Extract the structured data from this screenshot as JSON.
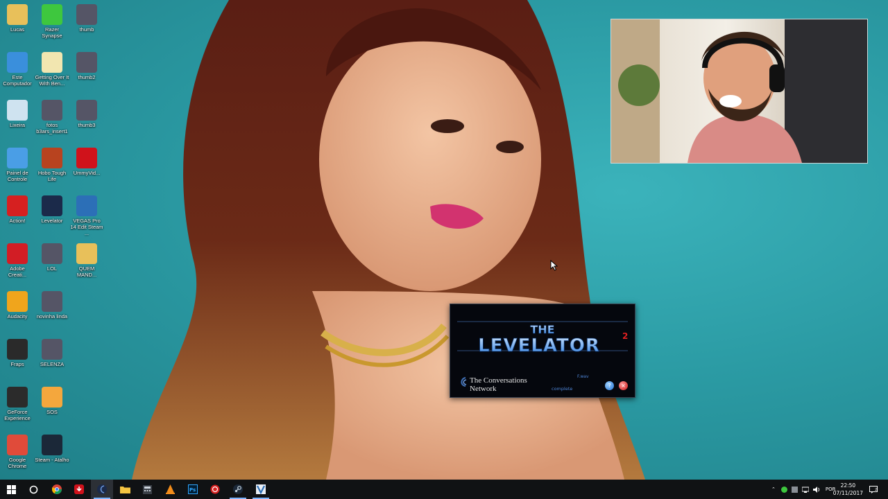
{
  "desktop": {
    "icons": [
      {
        "label": "Lucas",
        "icon": "folder-user-icon",
        "color": "#e8c05a"
      },
      {
        "label": "Razer Synapse",
        "icon": "razer-icon",
        "color": "#3ec73e"
      },
      {
        "label": "thumb",
        "icon": "image-thumb-icon",
        "color": "#556"
      },
      {
        "label": "Este Computador",
        "icon": "computer-icon",
        "color": "#3a8fdc"
      },
      {
        "label": "Getting Over It With Ben...",
        "icon": "file-icon",
        "color": "#f2e6b0"
      },
      {
        "label": "thumb2",
        "icon": "image-thumb-icon",
        "color": "#556"
      },
      {
        "label": "Lixeira",
        "icon": "recycle-bin-icon",
        "color": "#cfe3f0"
      },
      {
        "label": "fotos b3ars_insert1",
        "icon": "image-thumb-icon",
        "color": "#556"
      },
      {
        "label": "thumb3",
        "icon": "image-thumb-icon",
        "color": "#556"
      },
      {
        "label": "Painel de Controle",
        "icon": "control-panel-icon",
        "color": "#4a9ee6"
      },
      {
        "label": "Hobo Tough Life",
        "icon": "game-icon",
        "color": "#b8431f"
      },
      {
        "label": "UmmyVid...",
        "icon": "download-icon",
        "color": "#d0121b"
      },
      {
        "label": "Action!",
        "icon": "record-icon",
        "color": "#d62020"
      },
      {
        "label": "Levelator",
        "icon": "levelator-icon",
        "color": "#1b2a4a"
      },
      {
        "label": "VEGAS Pro 14 Edit Steam ...",
        "icon": "vegas-icon",
        "color": "#2c6fb7"
      },
      {
        "label": "Adobe Creati...",
        "icon": "adobe-cc-icon",
        "color": "#d21d25"
      },
      {
        "label": "LOL",
        "icon": "image-thumb-icon",
        "color": "#556"
      },
      {
        "label": "QUEM MAND...",
        "icon": "folder-icon",
        "color": "#e8c05a"
      },
      {
        "label": "Audacity",
        "icon": "audacity-icon",
        "color": "#f0a51c"
      },
      {
        "label": "novinha linda",
        "icon": "image-thumb-icon",
        "color": "#556"
      },
      {
        "label": "Fraps",
        "icon": "fraps-icon",
        "color": "#2a2a2a"
      },
      {
        "label": "SELENZA",
        "icon": "image-thumb-icon",
        "color": "#556"
      },
      {
        "label": "GeForce Experience",
        "icon": "nvidia-icon",
        "color": "#2b2b2b"
      },
      {
        "label": "SOS",
        "icon": "sos-icon",
        "color": "#f4a73d"
      },
      {
        "label": "Google Chrome",
        "icon": "chrome-icon",
        "color": "#e04b3a"
      },
      {
        "label": "Steam - Atalho",
        "icon": "steam-icon",
        "color": "#1b2838"
      }
    ]
  },
  "levelator": {
    "logo_line1": "THE",
    "logo_line2": "LEVELATOR",
    "logo_sup": "2",
    "network_line1": "The Conversations",
    "network_line2": "Network",
    "file": "F.wav",
    "status": "complete",
    "help_label": "?",
    "close_label": "×"
  },
  "taskbar": {
    "language": "POR",
    "time": "22:50",
    "date": "07/11/2017",
    "apps": [
      {
        "name": "start-button",
        "icon": "windows-icon"
      },
      {
        "name": "search-button",
        "icon": "search-icon"
      },
      {
        "name": "taskbar-chrome",
        "icon": "chrome-icon"
      },
      {
        "name": "taskbar-ummy",
        "icon": "download-icon"
      },
      {
        "name": "taskbar-levelator",
        "icon": "levelator-icon"
      },
      {
        "name": "taskbar-explorer",
        "icon": "folder-icon"
      },
      {
        "name": "taskbar-calculator",
        "icon": "calculator-icon"
      },
      {
        "name": "taskbar-vlc",
        "icon": "vlc-icon"
      },
      {
        "name": "taskbar-photoshop",
        "icon": "photoshop-icon"
      },
      {
        "name": "taskbar-action",
        "icon": "record-icon"
      },
      {
        "name": "taskbar-steam",
        "icon": "steam-icon"
      },
      {
        "name": "taskbar-vegas",
        "icon": "vegas-icon"
      }
    ]
  }
}
